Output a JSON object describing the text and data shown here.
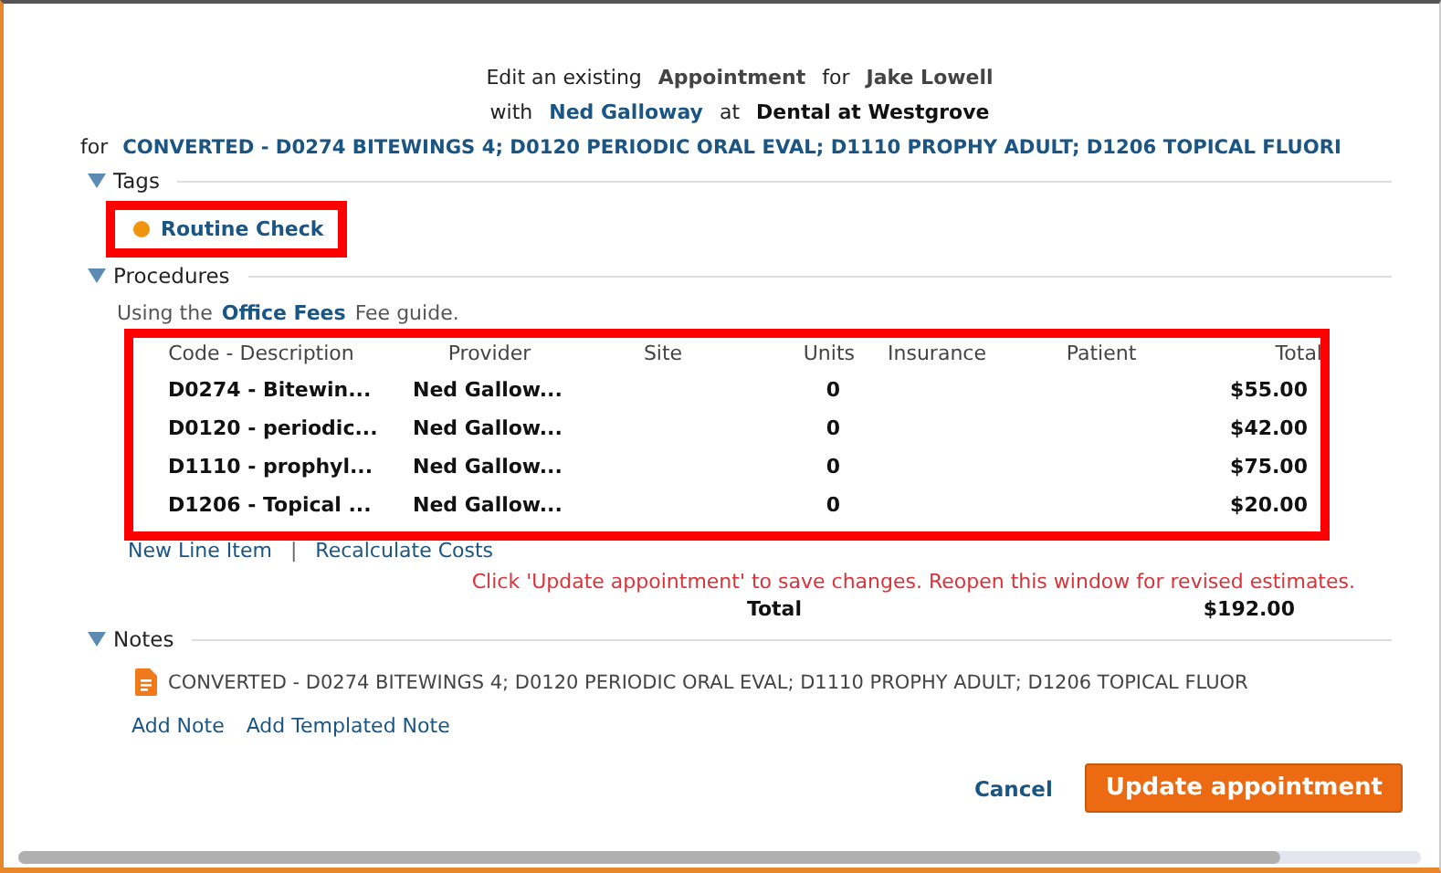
{
  "header": {
    "line1": [
      {
        "kind": "plain",
        "text": "Edit an existing"
      },
      {
        "kind": "strong",
        "text": "Appointment"
      },
      {
        "kind": "plain",
        "text": "for"
      },
      {
        "kind": "strong",
        "text": "Jake Lowell"
      }
    ],
    "line2": [
      {
        "kind": "plain",
        "text": "with"
      },
      {
        "kind": "link",
        "text": "Ned Galloway"
      },
      {
        "kind": "plain",
        "text": "at"
      },
      {
        "kind": "dark",
        "text": "Dental at Westgrove"
      }
    ],
    "line3": [
      {
        "kind": "plain",
        "text": "for"
      },
      {
        "kind": "link",
        "text": "CONVERTED - D0274 BITEWINGS 4; D0120 PERIODIC ORAL EVAL; D1110 PROPHY ADULT; D1206 TOPICAL FLUORI"
      }
    ]
  },
  "tags": {
    "title": "Tags",
    "expanded": true,
    "highlighted": true,
    "items": [
      {
        "label": "Routine Check",
        "color": "#f0940e"
      }
    ]
  },
  "procedures": {
    "title": "Procedures",
    "expanded": true,
    "fee_prefix": "Using the",
    "fee_guide": "Office Fees",
    "fee_suffix": "Fee guide.",
    "highlighted": true,
    "columns": [
      "Code - Description",
      "Provider",
      "Site",
      "Units",
      "Insurance",
      "Patient",
      "Total"
    ],
    "rows": [
      {
        "code": "D0274 - Bitewin...",
        "provider": "Ned Gallow...",
        "units": "0",
        "total": "$55.00"
      },
      {
        "code": "D0120 - periodic...",
        "provider": "Ned Gallow...",
        "units": "0",
        "total": "$42.00"
      },
      {
        "code": "D1110 - prophyl...",
        "provider": "Ned Gallow...",
        "units": "0",
        "total": "$75.00"
      },
      {
        "code": "D1206 - Topical ...",
        "provider": "Ned Gallow...",
        "units": "0",
        "total": "$20.00"
      }
    ],
    "links": [
      "New Line Item",
      "Recalculate Costs"
    ],
    "separator": "|",
    "warning": "Click 'Update appointment' to save changes. Reopen this window for revised estimates.",
    "total_label": "Total",
    "total_value": "$192.00"
  },
  "notes": {
    "title": "Notes",
    "expanded": true,
    "items": [
      "CONVERTED - D0274 BITEWINGS 4; D0120 PERIODIC ORAL EVAL; D1110 PROPHY ADULT; D1206 TOPICAL FLUOR"
    ],
    "links": [
      "Add Note",
      "Add Templated Note"
    ]
  },
  "buttons": {
    "cancel": "Cancel",
    "primary": "Update appointment"
  }
}
